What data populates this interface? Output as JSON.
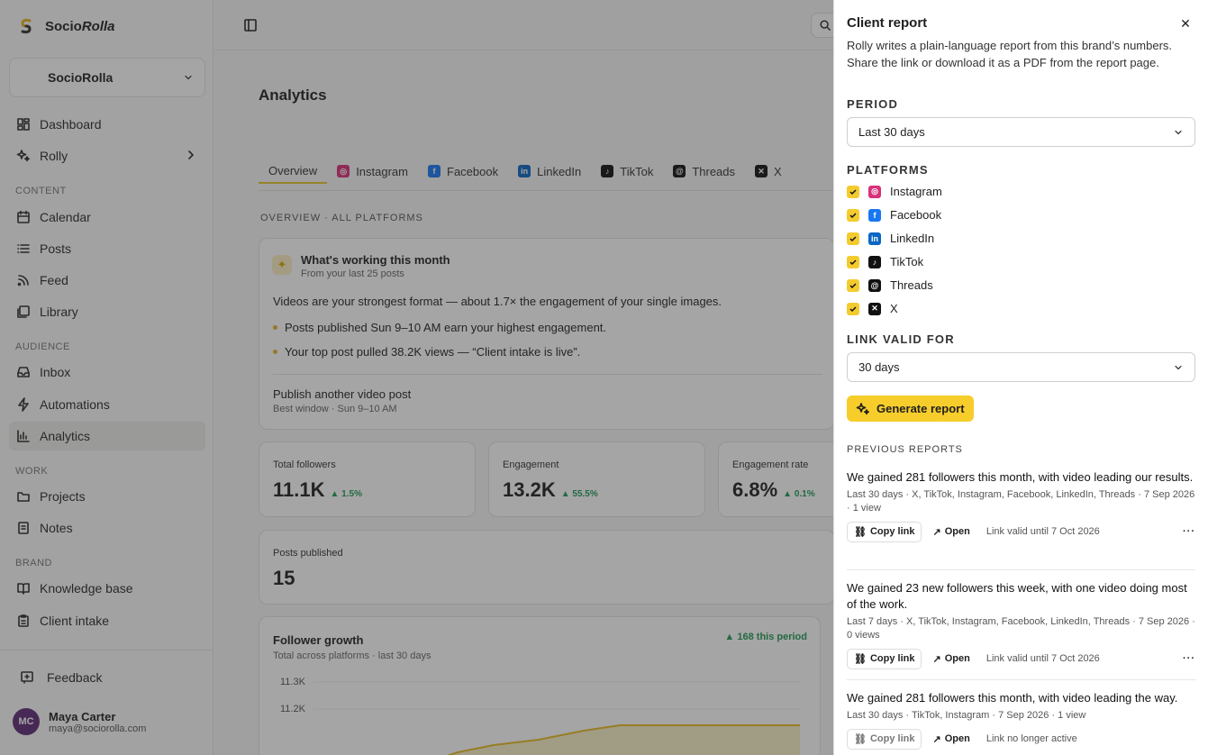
{
  "brand": {
    "name_prefix": "Socio",
    "name_suffix": "Rolla"
  },
  "workspace": {
    "name": "SocioRolla"
  },
  "nav": {
    "dashboard": "Dashboard",
    "rolly": "Rolly",
    "section_content": "CONTENT",
    "calendar": "Calendar",
    "posts": "Posts",
    "feed": "Feed",
    "library": "Library",
    "section_audience": "AUDIENCE",
    "inbox": "Inbox",
    "automations": "Automations",
    "analytics": "Analytics",
    "section_work": "WORK",
    "projects": "Projects",
    "notes": "Notes",
    "section_brand": "BRAND",
    "knowledge_base": "Knowledge base",
    "client_intake": "Client intake",
    "feedback": "Feedback"
  },
  "user": {
    "initials": "MC",
    "name": "Maya Carter",
    "email": "maya@sociorolla.com"
  },
  "main": {
    "title": "Analytics",
    "tabs": [
      "Overview",
      "Instagram",
      "Facebook",
      "LinkedIn",
      "TikTok",
      "Threads",
      "X"
    ],
    "overview_label": "OVERVIEW · ALL PLATFORMS",
    "working": {
      "title": "What's working this month",
      "subtitle": "From your last 25 posts",
      "headline": "Videos are your strongest format — about 1.7× the engagement of your single images.",
      "bullets": [
        "Posts published Sun 9–10 AM earn your highest engagement.",
        "Your top post pulled 38.2K views — “Client intake is live”."
      ],
      "action": "Publish another video post",
      "action_sub": "Best window · Sun 9–10 AM"
    },
    "stats": [
      {
        "label": "Total followers",
        "value": "11.1K",
        "delta": "▲ 1.5%"
      },
      {
        "label": "Engagement",
        "value": "13.2K",
        "delta": "▲ 55.5%"
      },
      {
        "label": "Engagement rate",
        "value": "6.8%",
        "delta": "▲ 0.1%"
      }
    ],
    "posts_published": {
      "label": "Posts published",
      "value": "15"
    },
    "growth": {
      "title": "Follower growth",
      "subtitle": "Total across platforms · last 30 days",
      "delta": "▲ 168 this period",
      "yticks": [
        "11.3K",
        "11.2K"
      ]
    }
  },
  "panel": {
    "title": "Client report",
    "description": "Rolly writes a plain-language report from this brand’s numbers. Share the link or download it as a PDF from the report page.",
    "period_label": "PERIOD",
    "period_value": "Last 30 days",
    "platforms_label": "PLATFORMS",
    "platforms": [
      "Instagram",
      "Facebook",
      "LinkedIn",
      "TikTok",
      "Threads",
      "X"
    ],
    "link_valid_label": "LINK VALID FOR",
    "link_valid_value": "30 days",
    "generate_label": "Generate report",
    "previous_label": "PREVIOUS REPORTS",
    "copy_link": "Copy link",
    "open": "Open",
    "reports": [
      {
        "title": "We gained 281 followers this month, with video leading our results.",
        "meta": "Last 30 days · X, TikTok, Instagram, Facebook, LinkedIn, Threads · 7 Sep 2026 · 1 view",
        "validity": "Link valid until 7 Oct 2026"
      },
      {
        "title": "We gained 23 new followers this week, with one video doing most of the work.",
        "meta": "Last 7 days · X, TikTok, Instagram, Facebook, LinkedIn, Threads · 7 Sep 2026 · 0 views",
        "validity": "Link valid until 7 Oct 2026"
      },
      {
        "title": "We gained 281 followers this month, with video leading the way.",
        "meta": "Last 30 days · TikTok, Instagram · 7 Sep 2026 · 1 view",
        "validity": "Link no longer active"
      }
    ]
  },
  "colors": {
    "accent": "#f6cd2b",
    "positive": "#1f9a55",
    "instagram": "#d9307a",
    "facebook": "#1877f2",
    "linkedin": "#0a66c2"
  }
}
